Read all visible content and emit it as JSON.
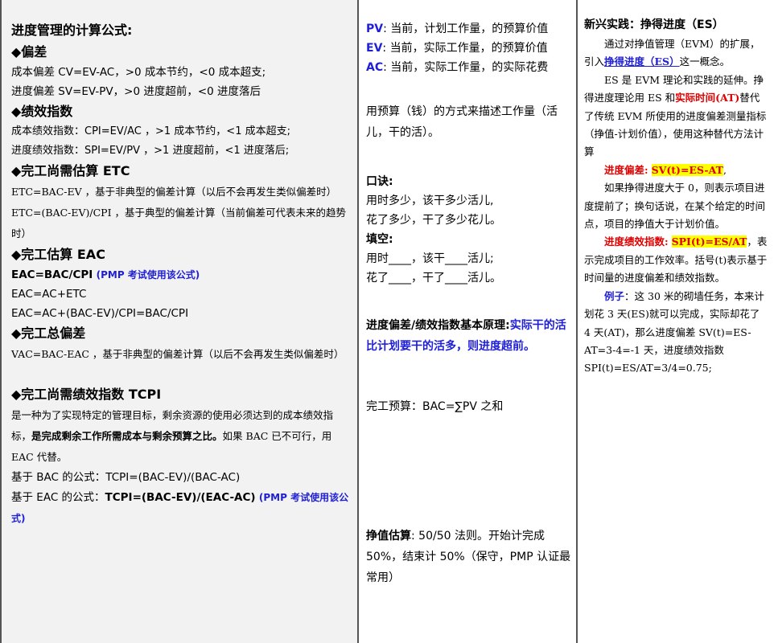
{
  "col1": {
    "title": "进度管理的计算公式:",
    "sec1": "◆偏差",
    "cv": "成本偏差 CV=EV-AC，>0 成本节约，<0 成本超支;",
    "sv": "进度偏差 SV=EV-PV，>0 进度超前，<0 进度落后",
    "sec2": "◆绩效指数",
    "cpi": "成本绩效指数：CPI=EV/AC ，>1 成本节约，<1 成本超支;",
    "spi": "进度绩效指数：SPI=EV/PV ，>1 进度超前，<1 进度落后;",
    "sec3": "◆完工尚需估算 ETC",
    "etc1": "ETC=BAC-EV ，基于非典型的偏差计算（以后不会再发生类似偏差时）",
    "etc2": "ETC=(BAC-EV)/CPI ，基于典型的偏差计算（当前偏差可代表未来的趋势时）",
    "sec4": "◆完工估算 EAC",
    "eac1": "EAC=BAC/CPI",
    "eac1_note": "(PMP 考试使用该公式)",
    "eac2": "EAC=AC+ETC",
    "eac3": "EAC=AC+(BAC-EV)/CPI=BAC/CPI",
    "sec5": "◆完工总偏差",
    "vac": "VAC=BAC-EAC ，基于非典型的偏差计算（以后不会再发生类似偏差时）",
    "sec6": "◆完工尚需绩效指数 TCPI",
    "tcpi_desc_a": "是一种为了实现特定的管理目标，剩余资源的使用必须达到的成本绩效指标，",
    "tcpi_desc_b": "是完成剩余工作所需成本与剩余预算之比。",
    "tcpi_desc_c": "如果 BAC 已不可行，用 EAC 代替。",
    "tcpi_bac": "基于 BAC 的公式：TCPI=(BAC-EV)/(BAC-AC)",
    "tcpi_eac_label": "基于 EAC 的公式：",
    "tcpi_eac_formula": "TCPI=(BAC-EV)/(EAC-AC)",
    "tcpi_eac_note": "(PMP 考试使用该公式)"
  },
  "col2": {
    "pv_key": "PV",
    "pv_text": ": 当前，计划工作量，的预算价值",
    "ev_key": "EV",
    "ev_text": ": 当前，实际工作量，的预算价值",
    "ac_key": "AC",
    "ac_text": ": 当前，实际工作量，的实际花费",
    "desc": "用预算（钱）的方式来描述工作量（活儿，干的活）。",
    "koujue": "口诀:",
    "k1": "用时多少，该干多少活儿,",
    "k2": "花了多少，干了多少花儿。",
    "tiankong": "填空:",
    "t1": "用时____，该干____活儿;",
    "t2": "花了____，干了____活儿。",
    "principle_label": "进度偏差/绩效指数基本原理:",
    "principle_text": "实际干的活比计划要干的活多，则进度超前。",
    "bac": "完工预算：BAC=∑PV 之和",
    "estimate_label": "挣值估算",
    "estimate_text": ": 50/50 法则。开始计完成 50%，结束计 50%（保守，PMP 认证最常用）"
  },
  "col3": {
    "title": "新兴实践：挣得进度（ES）",
    "p1_a": "通过对挣值管理（EVM）的扩展，引入",
    "p1_term": "挣得进度（ES）",
    "p1_b": "这一概念。",
    "p2_a": "ES 是 EVM 理论和实践的延伸。挣得进度理论用 ES 和",
    "p2_term": "实际时间(AT)",
    "p2_b": "替代了传统 EVM 所使用的进度偏差测量指标（挣值-计划价值），使用这种替代方法计算",
    "sv_label": "进度偏差:",
    "sv_formula": "SV(t)=ES-AT",
    "sv_tail": ",",
    "p3": "如果挣得进度大于 0，则表示项目进度提前了；换句话说，在某个给定的时间点，项目的挣值大于计划价值。",
    "spi_label": "进度绩效指数:",
    "spi_formula": "SPI(t)=ES/AT",
    "spi_tail": "，表示完成项目的工作效率。括号(t)表示基于时间量的进度偏差和绩效指数。",
    "ex_label": "例子",
    "ex_text": "：这 30 米的砌墙任务，本来计划花 3 天(ES)就可以完成，实际却花了 4 天(AT)，那么进度偏差 SV(t)=ES-AT=3-4=-1 天，进度绩效指数 SPI(t)=ES/AT=3/4=0.75;"
  }
}
